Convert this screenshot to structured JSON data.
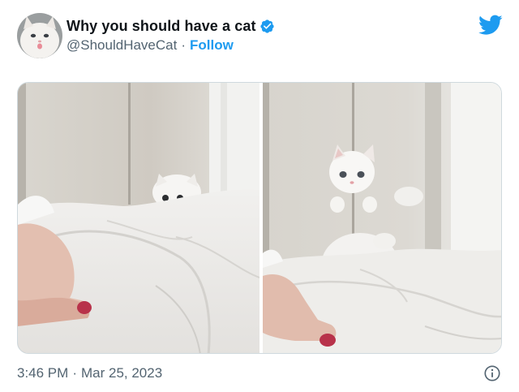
{
  "author": {
    "display_name": "Why you should have a cat",
    "handle": "@ShouldHaveCat",
    "separator": "·",
    "follow_label": "Follow",
    "verified_icon": "verified-badge-icon",
    "avatar_icon": "cat-avatar"
  },
  "brand": {
    "icon": "twitter-bird-icon",
    "color": "#1d9bf0"
  },
  "media": {
    "photos": [
      {
        "name": "kitten-peeking-over-blanket"
      },
      {
        "name": "kitten-leaping-over-blanket"
      }
    ]
  },
  "footer": {
    "time": "3:46 PM",
    "separator": "·",
    "date": "Mar 25, 2023",
    "info_icon": "info-icon"
  },
  "colors": {
    "text_primary": "#0f1419",
    "text_secondary": "#536471",
    "accent": "#1d9bf0",
    "border": "#cfd9de"
  }
}
